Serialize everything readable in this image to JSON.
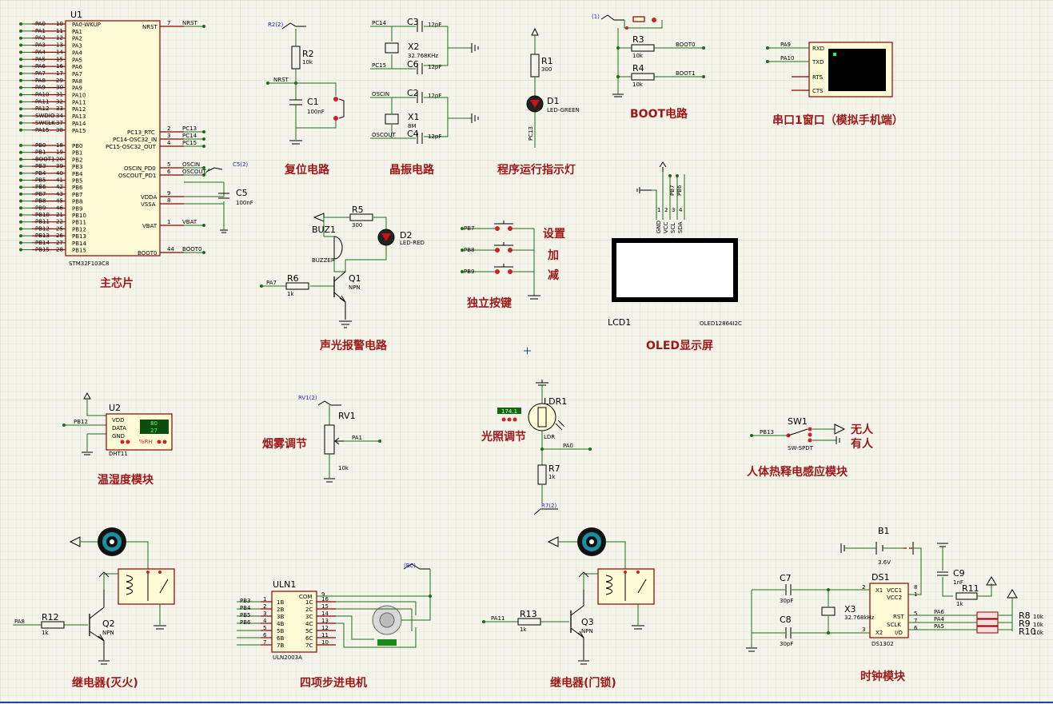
{
  "labels": {
    "u1": "U1",
    "u1_part": "STM32F103C8",
    "nrst": "NRST",
    "boot0": "BOOT0",
    "pc13": "PC13",
    "pc14": "PC14",
    "pc15": "PC15",
    "oscin": "OSCIN",
    "oscout": "OSCOUT",
    "vdda": "VDDA",
    "vssa": "VSSA",
    "vbat": "VBAT",
    "pc13_rtc": "PC13_RTC",
    "pc14_osc": "PC14-OSC32_IN",
    "pc15_osc": "PC15-OSC32_OUT",
    "oscin_pd0": "OSCIN_PD0",
    "oscout_pd1": "OSCOUT_PD1",
    "r2": "R2",
    "r2_val": "10k",
    "c1": "C1",
    "c1_val": "100nF",
    "r2_tag": "R2(2)",
    "c3": "C3",
    "c4": "C4",
    "c6": "C6",
    "c2": "C2",
    "c12pf": "12pF",
    "x2": "X2",
    "x2_val": "32.768KHz",
    "x1": "X1",
    "x1_val": "8M",
    "pc14_n": "PC14",
    "pc15_n": "PC15",
    "oscin_n": "OSCIN",
    "oscout_n": "OSCOUT",
    "r1": "R1",
    "r1_val": "300",
    "d1": "D1",
    "d1_val": "LED-GREEN",
    "pc13_n": "PC13",
    "r3": "R3",
    "r4": "R4",
    "r10k": "10k",
    "boot0_n": "BOOT0",
    "boot1_n": "BOOT1",
    "one_tag": "(1)",
    "pa9": "PA9",
    "pa10": "PA10",
    "rxd": "RXD",
    "txd": "TXD",
    "rts": "RTS",
    "cts": "CTS",
    "c5": "C5",
    "c5_val": "100nF",
    "c5_tag": "C5(2)",
    "r5": "R5",
    "r5_val": "300",
    "d2": "D2",
    "d2_val": "LED-RED",
    "buz1": "BUZ1",
    "buzzer": "BUZZER",
    "r6": "R6",
    "r6_val": "1k",
    "q1": "Q1",
    "npn": "NPN",
    "pa7": "PA7",
    "pb7": "PB7",
    "pb8": "PB8",
    "pb9": "PB9",
    "set": "设置",
    "add": "加",
    "sub": "减",
    "lcd1": "LCD1",
    "oled_part": "OLED12864I2C",
    "gnd": "GND",
    "vcc": "VCC",
    "scl": "SCL",
    "sda": "SDA",
    "pb7v": "PB7",
    "pb6v": "PB6",
    "u2": "U2",
    "dht_part": "DHT11",
    "vdd": "VDD",
    "data": "DATA",
    "gnd2": "GND",
    "pb12": "PB12",
    "dht_t": "80",
    "dht_h": "27",
    "rh": "%RH",
    "rv1": "RV1",
    "rv1_tag": "RV1(2)",
    "rv1_val": "10k",
    "pa1": "PA1",
    "ldr1": "LDR1",
    "ldr": "LDR",
    "ldr_val": "174.1",
    "pa0": "PA0",
    "r7": "R7",
    "r7_val": "1k",
    "r7_tag": "R7(2)",
    "sw1": "SW1",
    "sw_part": "SW-SPDT",
    "pb13": "PB13",
    "none": "无人",
    "some": "有人",
    "r12": "R12",
    "r12_val": "1k",
    "q2": "Q2",
    "pa8": "PA8",
    "uln1": "ULN1",
    "uln_part": "ULN2003A",
    "com": "COM",
    "bc_tag": "(BC)",
    "pb3": "PB3",
    "pb4": "PB4",
    "pb5": "PB5",
    "pb6": "PB6",
    "r13": "R13",
    "r13_val": "1k",
    "q3": "Q3",
    "pa11": "PA11",
    "b1": "B1",
    "b1_val": "3.6V",
    "c7": "C7",
    "c8": "C8",
    "c30p": "30pF",
    "x3": "X3",
    "x3_val": "32.768kHz",
    "c9": "C9",
    "c9_val": "1nF",
    "r11": "R11",
    "r11_val": "1k",
    "ds1": "DS1",
    "ds_part": "DS1302",
    "vcc1": "VCC1",
    "vcc2": "VCC2",
    "x1p": "X1",
    "x2p": "X2",
    "rst": "RST",
    "sclk": "SCLK",
    "io": "I/O",
    "pa6": "PA6",
    "pa4": "PA4",
    "pa5": "PA5",
    "r8": "R8",
    "r9": "R9",
    "r10": "R10"
  },
  "titles": {
    "main_chip": "主芯片",
    "reset": "复位电路",
    "crystal": "晶振电路",
    "run_led": "程序运行指示灯",
    "boot": "BOOT电路",
    "uart": "串口1窗口（模拟手机端）",
    "alarm": "声光报警电路",
    "keys": "独立按键",
    "oled": "OLED显示屏",
    "dht": "温湿度模块",
    "smoke": "烟雾调节",
    "light": "光照调节",
    "pir": "人体热释电感应模块",
    "relay1": "继电器(灭火)",
    "stepper": "四项步进电机",
    "relay2": "继电器(门锁)",
    "clock": "时钟模块"
  },
  "u1_left_pins": [
    {
      "name": "PA0",
      "num": "10"
    },
    {
      "name": "PA1",
      "num": "11"
    },
    {
      "name": "PA2",
      "num": "12"
    },
    {
      "name": "PA3",
      "num": "13"
    },
    {
      "name": "PA4",
      "num": "14"
    },
    {
      "name": "PA5",
      "num": "15"
    },
    {
      "name": "PA6",
      "num": "16"
    },
    {
      "name": "PA7",
      "num": "17"
    },
    {
      "name": "PA8",
      "num": "29"
    },
    {
      "name": "PA9",
      "num": "30"
    },
    {
      "name": "PA10",
      "num": "31"
    },
    {
      "name": "PA11",
      "num": "32"
    },
    {
      "name": "PA12",
      "num": "33"
    },
    {
      "name": "SWDIO",
      "num": "34"
    },
    {
      "name": "SWCLK",
      "num": "37"
    },
    {
      "name": "PA15",
      "num": "38"
    },
    {
      "name": "PB0",
      "num": "18"
    },
    {
      "name": "PB1",
      "num": "19"
    },
    {
      "name": "BOOT1",
      "num": "20"
    },
    {
      "name": "PB3",
      "num": "39"
    },
    {
      "name": "PB4",
      "num": "40"
    },
    {
      "name": "PB5",
      "num": "41"
    },
    {
      "name": "PB6",
      "num": "42"
    },
    {
      "name": "PB7",
      "num": "43"
    },
    {
      "name": "PB8",
      "num": "45"
    },
    {
      "name": "PB9",
      "num": "46"
    },
    {
      "name": "PB10",
      "num": "21"
    },
    {
      "name": "PB11",
      "num": "22"
    },
    {
      "name": "PB12",
      "num": "25"
    },
    {
      "name": "PB13",
      "num": "26"
    },
    {
      "name": "PB14",
      "num": "27"
    },
    {
      "name": "PB15",
      "num": "28"
    }
  ],
  "u1_inner_pins": [
    "PA0-WKUP",
    "PA1",
    "PA2",
    "PA3",
    "PA4",
    "PA5",
    "PA6",
    "PA7",
    "PA8",
    "PA9",
    "PA10",
    "PA11",
    "PA12",
    "PA13",
    "PA14",
    "PA15",
    "PB0",
    "PB1",
    "PB2",
    "PB3",
    "PB4",
    "PB5",
    "PB6",
    "PB7",
    "PB8",
    "PB9",
    "PB10",
    "PB11",
    "PB12",
    "PB13",
    "PB14",
    "PB15"
  ],
  "u1_right_nums": {
    "nrst": "7",
    "pc13": "2",
    "pc14": "3",
    "pc15": "4",
    "oscin": "5",
    "oscout": "6",
    "vdda": "9",
    "vssa": "8",
    "vbat": "1",
    "boot0": "44"
  },
  "uln_in": [
    "1B",
    "2B",
    "3B",
    "4B",
    "5B",
    "6B",
    "7B"
  ],
  "uln_in_num": [
    "1",
    "2",
    "3",
    "4",
    "5",
    "6",
    "7"
  ],
  "uln_out": [
    "1C",
    "2C",
    "3C",
    "4C",
    "5C",
    "6C",
    "7C"
  ],
  "uln_out_num": [
    "16",
    "15",
    "14",
    "13",
    "12",
    "11",
    "10"
  ],
  "uln_com_num": "9",
  "ds_pins": {
    "x1": "2",
    "x2": "3",
    "vcc1": "8",
    "vcc2": "1",
    "rst": "5",
    "sclk": "7",
    "io": "6"
  },
  "r8_val": "10k",
  "r9_val": "10k",
  "r10_val": "10k",
  "oled_pins": [
    "1",
    "2",
    "3",
    "4"
  ]
}
